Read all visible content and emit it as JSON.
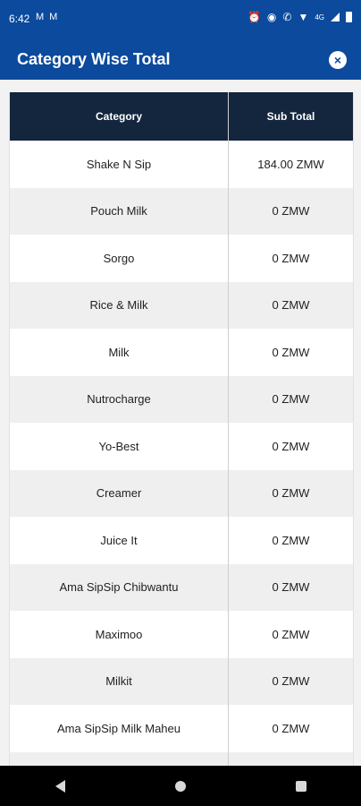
{
  "status_bar": {
    "time": "6:42",
    "left_icons": [
      "gmail-icon",
      "gmail-icon"
    ],
    "network_label": "4G"
  },
  "header": {
    "title": "Category Wise Total",
    "close_icon": "close-icon"
  },
  "table": {
    "headers": [
      "Category",
      "Sub Total"
    ],
    "rows": [
      {
        "category": "Shake N Sip",
        "subtotal": "184.00 ZMW"
      },
      {
        "category": "Pouch Milk",
        "subtotal": "0 ZMW"
      },
      {
        "category": "Sorgo",
        "subtotal": "0 ZMW"
      },
      {
        "category": "Rice & Milk",
        "subtotal": "0 ZMW"
      },
      {
        "category": "Milk",
        "subtotal": "0 ZMW"
      },
      {
        "category": "Nutrocharge",
        "subtotal": "0 ZMW"
      },
      {
        "category": "Yo-Best",
        "subtotal": "0 ZMW"
      },
      {
        "category": "Creamer",
        "subtotal": "0 ZMW"
      },
      {
        "category": "Juice It",
        "subtotal": "0 ZMW"
      },
      {
        "category": "Ama SipSip Chibwantu",
        "subtotal": "0 ZMW"
      },
      {
        "category": "Maximoo",
        "subtotal": "0 ZMW"
      },
      {
        "category": "Milkit",
        "subtotal": "0 ZMW"
      },
      {
        "category": "Ama SipSip Milk Maheu",
        "subtotal": "0 ZMW"
      },
      {
        "category": "",
        "subtotal": ""
      }
    ]
  },
  "colors": {
    "header_blue": "#0b4a9c",
    "table_header": "#14263e"
  }
}
